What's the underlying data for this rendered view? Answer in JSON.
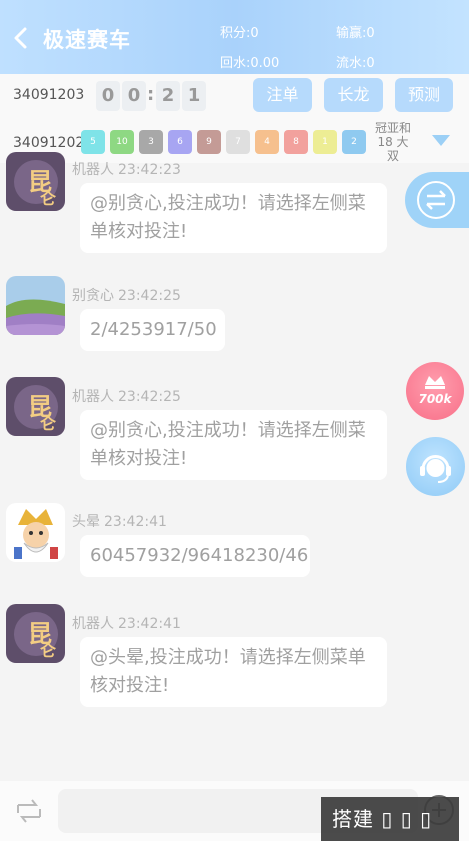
{
  "header": {
    "title": "极速赛车",
    "stats": [
      {
        "label": "积分:0"
      },
      {
        "label": "输赢:0"
      },
      {
        "label": "回水:0.00"
      },
      {
        "label": "流水:0"
      }
    ]
  },
  "countdown": {
    "round": "34091203",
    "digits": [
      "0",
      "0",
      "2",
      "1"
    ],
    "separator": ":"
  },
  "actions": {
    "bet_label": "注单",
    "dragon_label": "长龙",
    "predict_label": "预测"
  },
  "last_result": {
    "round": "34091202",
    "balls": [
      {
        "num": "5",
        "color": "#7fe3e8"
      },
      {
        "num": "10",
        "color": "#8ed883"
      },
      {
        "num": "3",
        "color": "#a8a8a8"
      },
      {
        "num": "6",
        "color": "#a7a5f2"
      },
      {
        "num": "9",
        "color": "#c49b96"
      },
      {
        "num": "7",
        "color": "#dfdfdf"
      },
      {
        "num": "4",
        "color": "#f6c08e"
      },
      {
        "num": "8",
        "color": "#f2a19d"
      },
      {
        "num": "1",
        "color": "#eded94"
      },
      {
        "num": "2",
        "color": "#8fcaf0"
      }
    ],
    "sum_line1": "冠亚和",
    "sum_line2": "18 大",
    "sum_line3": "双"
  },
  "messages": [
    {
      "sender": "机器人",
      "time": "23:42:23",
      "avatar": "robot-avatar",
      "line1": "@别贪心,投注成功！请选择左侧菜",
      "line2": "单核对投注!"
    },
    {
      "sender": "别贪心",
      "time": "23:42:25",
      "avatar": "landscape-avatar",
      "line1": "2/4253917/50",
      "line2": ""
    },
    {
      "sender": "机器人",
      "time": "23:42:25",
      "avatar": "robot-avatar",
      "line1": "@别贪心,投注成功！请选择左侧菜",
      "line2": "单核对投注!"
    },
    {
      "sender": "头晕",
      "time": "23:42:41",
      "avatar": "cartoon-avatar",
      "line1": "60457932/96418230/46",
      "line2": ""
    },
    {
      "sender": "机器人",
      "time": "23:42:41",
      "avatar": "robot-avatar",
      "line1": "@头晕,投注成功！请选择左侧菜单",
      "line2": "核对投注!"
    }
  ],
  "floating": {
    "promo_label": "700k"
  },
  "overlay_text": "搭建 ▯ ▯ ▯",
  "colors": {
    "header_bg": "#a9d2fb",
    "button_bg": "#b6dafc",
    "promo": "#f86f88",
    "service": "#8fcaf6"
  }
}
